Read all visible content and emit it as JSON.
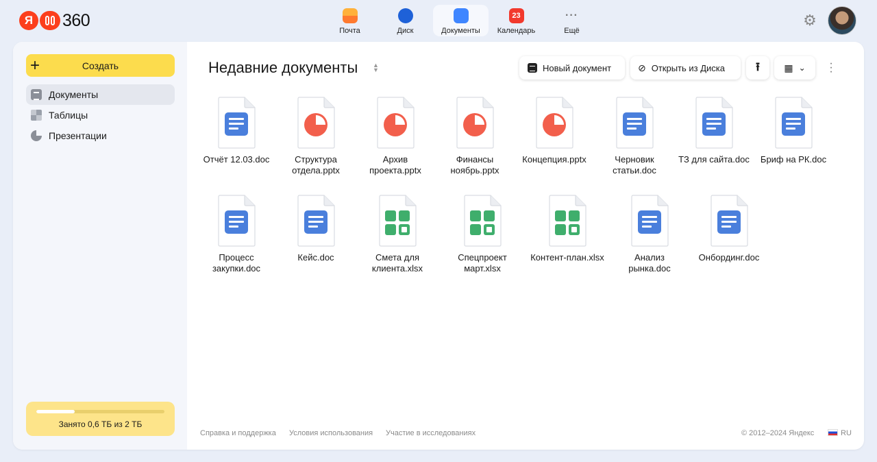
{
  "header": {
    "logo_text": "360",
    "services": [
      {
        "label": "Почта",
        "icon": "mail-icon"
      },
      {
        "label": "Диск",
        "icon": "disk-icon"
      },
      {
        "label": "Документы",
        "icon": "documents-icon"
      },
      {
        "label": "Календарь",
        "icon": "calendar-icon",
        "badge": "23"
      },
      {
        "label": "Ещё",
        "icon": "more-icon"
      }
    ]
  },
  "sidebar": {
    "create_label": "Создать",
    "items": [
      {
        "label": "Документы"
      },
      {
        "label": "Таблицы"
      },
      {
        "label": "Презентации"
      }
    ],
    "storage_text": "Занято 0,6 ТБ из 2 ТБ",
    "storage_used_fraction": 0.3
  },
  "main": {
    "title": "Недавние документы",
    "new_doc_label": "Новый документ",
    "open_disk_label": "Открыть из Диска",
    "files": [
      {
        "name": "Отчёт 12.03.doc",
        "kind": "doc"
      },
      {
        "name": "Структура отдела.pptx",
        "kind": "pptx"
      },
      {
        "name": "Архив проекта.pptx",
        "kind": "pptx"
      },
      {
        "name": "Финансы ноябрь.pptx",
        "kind": "pptx"
      },
      {
        "name": "Концепция.pptx",
        "kind": "pptx"
      },
      {
        "name": "Черновик статьи.doc",
        "kind": "doc"
      },
      {
        "name": "ТЗ для сайта.doc",
        "kind": "doc"
      },
      {
        "name": "Бриф на РК.doc",
        "kind": "doc"
      },
      {
        "name": "Процесс закупки.doc",
        "kind": "doc"
      },
      {
        "name": "Кейс.doc",
        "kind": "doc"
      },
      {
        "name": "Смета для клиента.xlsx",
        "kind": "xlsx"
      },
      {
        "name": "Спецпроект март.xlsx",
        "kind": "xlsx"
      },
      {
        "name": "Контент-план.xlsx",
        "kind": "xlsx"
      },
      {
        "name": "Анализ рынка.doc",
        "kind": "doc"
      },
      {
        "name": "Онбординг.doc",
        "kind": "doc"
      }
    ]
  },
  "footer": {
    "links": [
      "Справка и поддержка",
      "Условия использования",
      "Участие в исследованиях"
    ],
    "copyright": "© 2012–2024 Яндекс",
    "lang": "RU"
  },
  "colors": {
    "doc": "#4a7fdc",
    "pptx": "#f25f4c",
    "xlsx": "#3fae6c",
    "accent": "#fcdc4d"
  }
}
